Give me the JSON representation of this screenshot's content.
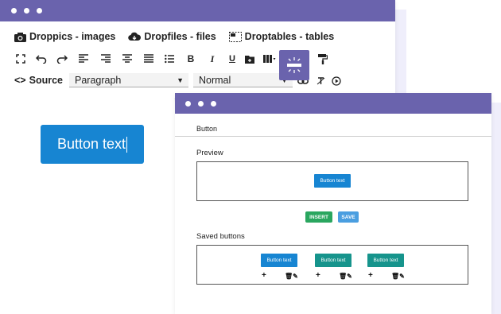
{
  "editor": {
    "toolbar": {
      "droppics": "Droppics - images",
      "dropfiles": "Dropfiles - files",
      "droptables": "Droptables - tables",
      "source": "Source",
      "block_format": "Paragraph",
      "font_size": "Normal"
    },
    "canvas_button": "Button text"
  },
  "dialog": {
    "title": "Button",
    "preview_label": "Preview",
    "preview_button": "Button text",
    "insert_label": "INSERT",
    "save_label": "SAVE",
    "saved_label": "Saved buttons",
    "saved_buttons": [
      {
        "text": "Button text",
        "color": "#1785d2"
      },
      {
        "text": "Button text",
        "color": "#16948c"
      },
      {
        "text": "Button text",
        "color": "#16948c"
      }
    ]
  },
  "colors": {
    "titlebar": "#6a63ad",
    "primary_button": "#1785d2",
    "insert_button": "#2aa65f",
    "save_button": "#4a9ee0",
    "saved_teal": "#16948c"
  }
}
